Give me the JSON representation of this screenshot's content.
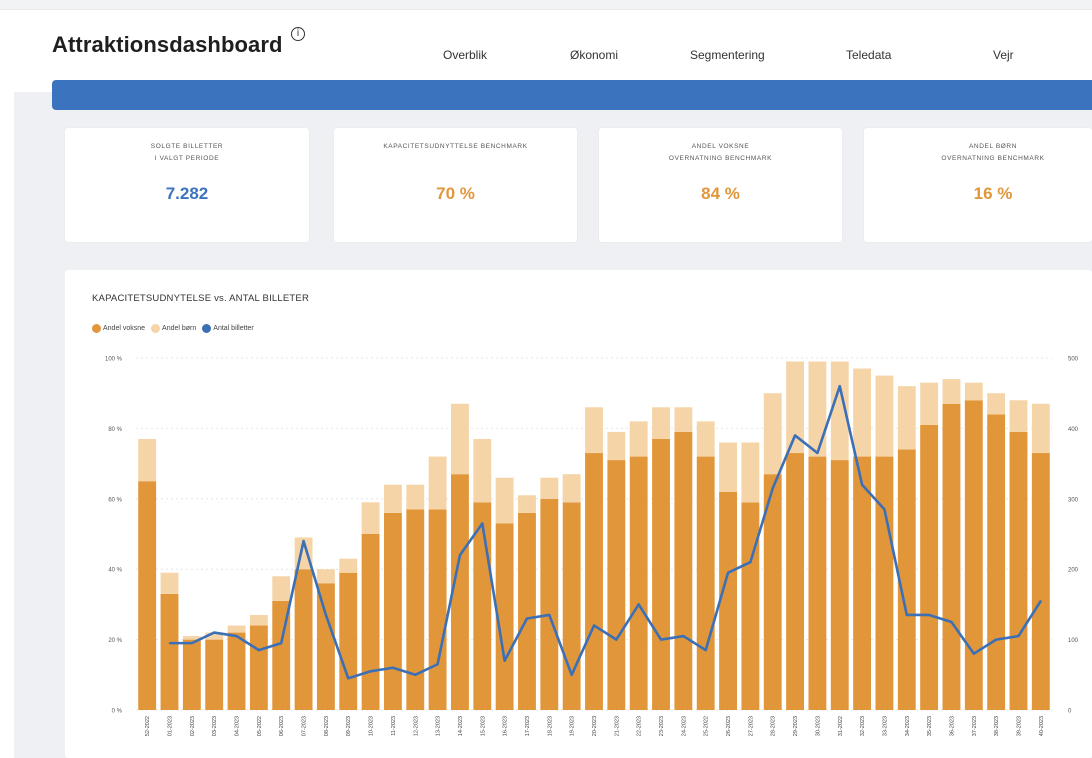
{
  "header": {
    "title": "Attraktionsdashboard",
    "info_icon": "info-icon",
    "nav": [
      {
        "label": "Overblik"
      },
      {
        "label": "Økonomi"
      },
      {
        "label": "Segmentering"
      },
      {
        "label": "Teledata"
      },
      {
        "label": "Vejr"
      }
    ],
    "bar_color": "#3b73bf"
  },
  "kpis": [
    {
      "label_line1": "SOLGTE BILLETTER",
      "label_line2": "I VALGT PERIODE",
      "value": "7.282",
      "color": "#3b73bf"
    },
    {
      "label_line1": "KAPACITETSUDNYTTELSE BENCHMARK",
      "label_line2": "",
      "value": "70 %",
      "color": "#e2963a"
    },
    {
      "label_line1": "ANDEL VOKSNE",
      "label_line2": "OVERNATNING BENCHMARK",
      "value": "84 %",
      "color": "#e2963a"
    },
    {
      "label_line1": "ANDEL BØRN",
      "label_line2": "OVERNATNING BENCHMARK",
      "value": "16 %",
      "color": "#e2963a"
    }
  ],
  "chart_data": {
    "type": "bar",
    "title": "KAPACITETSUDNYTELSE vs. ANTAL BILLETER",
    "legend_position": "top-left",
    "legend": [
      {
        "name": "Andel voksne",
        "color": "#e2963a"
      },
      {
        "name": "Andel børn",
        "color": "#f5d5a8"
      },
      {
        "name": "Antal billetter",
        "color": "#3b6fb6"
      }
    ],
    "categories": [
      "52-2022",
      "01-2023",
      "02-2023",
      "03-2023",
      "04-2023",
      "05-2022",
      "06-2023",
      "07-2023",
      "08-2023",
      "09-2023",
      "10-2023",
      "11-2023",
      "12-2023",
      "13-2023",
      "14-2023",
      "15-2023",
      "16-2023",
      "17-2023",
      "18-2023",
      "19-2023",
      "20-2023",
      "21-2023",
      "22-2023",
      "23-2023",
      "24-2023",
      "25-2022",
      "26-2023",
      "27-2023",
      "28-2023",
      "29-2023",
      "30-2023",
      "31-2022",
      "32-2023",
      "33-2023",
      "34-2023",
      "35-2023",
      "36-2023",
      "37-2023",
      "38-2023",
      "39-2023",
      "40-2023"
    ],
    "series": [
      {
        "name": "Andel voksne",
        "axis": "left",
        "stack": "kapacitet",
        "values": [
          65,
          33,
          20,
          20,
          22,
          24,
          31,
          40,
          36,
          39,
          50,
          56,
          57,
          57,
          67,
          59,
          53,
          56,
          60,
          59,
          73,
          71,
          72,
          77,
          79,
          72,
          62,
          59,
          67,
          73,
          72,
          71,
          72,
          72,
          74,
          81,
          87,
          88,
          84,
          79,
          73
        ]
      },
      {
        "name": "Andel børn",
        "axis": "left",
        "stack": "kapacitet",
        "values": [
          12,
          6,
          1,
          2,
          2,
          3,
          7,
          9,
          4,
          4,
          9,
          8,
          7,
          15,
          20,
          18,
          13,
          5,
          6,
          8,
          13,
          8,
          10,
          9,
          7,
          10,
          14,
          17,
          23,
          26,
          27,
          28,
          25,
          23,
          18,
          12,
          7,
          5,
          6,
          9,
          14
        ]
      },
      {
        "name": "Antal billetter",
        "axis": "right",
        "type": "line",
        "values": [
          95,
          95,
          110,
          105,
          85,
          95,
          240,
          135,
          45,
          55,
          60,
          50,
          65,
          220,
          265,
          70,
          130,
          135,
          50,
          120,
          100,
          150,
          100,
          105,
          85,
          195,
          210,
          315,
          390,
          365,
          460,
          320,
          285,
          135,
          135,
          125,
          80,
          100,
          105,
          155
        ]
      }
    ],
    "y_left": {
      "ticks": [
        "0 %",
        "20 %",
        "40 %",
        "60 %",
        "80 %",
        "100 %"
      ],
      "range": [
        0,
        100
      ]
    },
    "y_right": {
      "ticks": [
        "0",
        "100",
        "200",
        "300",
        "400",
        "500"
      ],
      "range": [
        0,
        500
      ]
    }
  }
}
